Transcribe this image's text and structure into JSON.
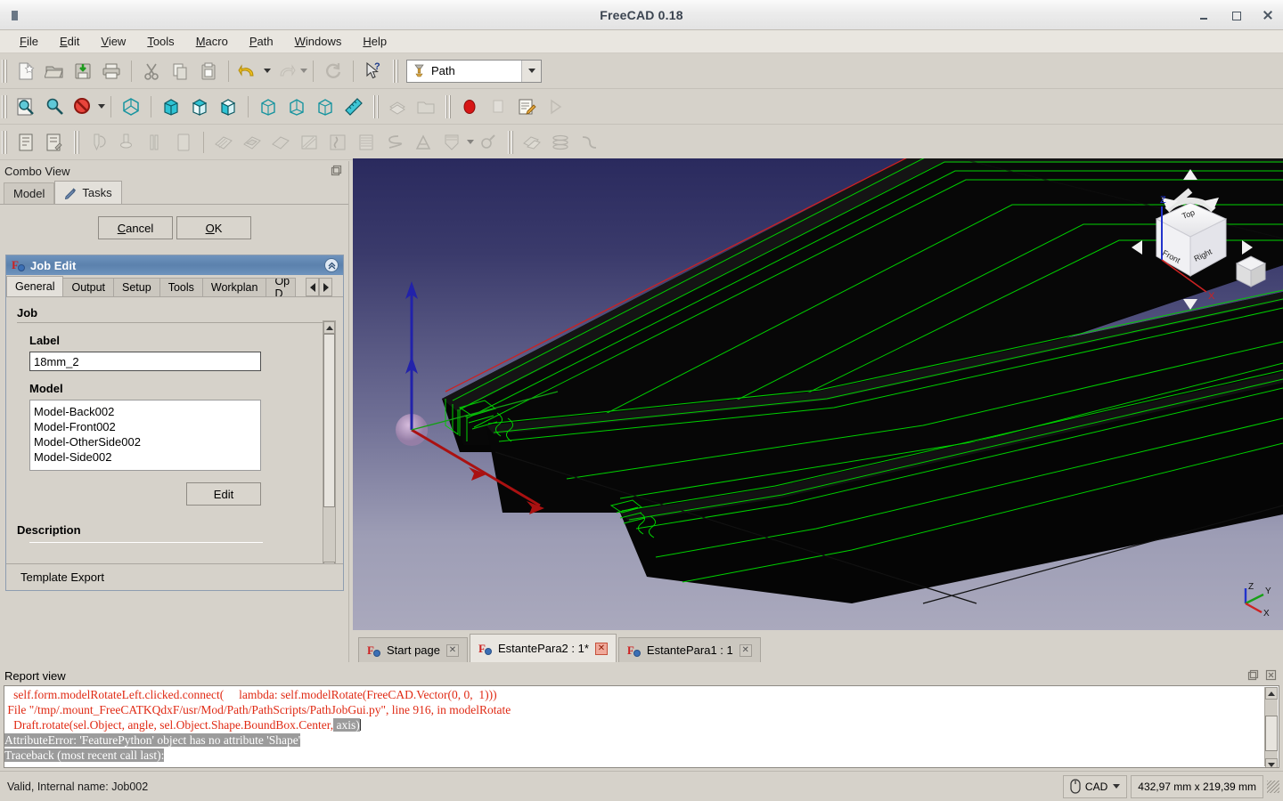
{
  "window": {
    "title": "FreeCAD 0.18",
    "app_icon": "freecad-icon",
    "controls": {
      "minimize": "minimize",
      "maximize": "maximize",
      "close": "close"
    }
  },
  "menubar": {
    "items": [
      {
        "label": "File",
        "mnemonic": "F"
      },
      {
        "label": "Edit",
        "mnemonic": "E"
      },
      {
        "label": "View",
        "mnemonic": "V"
      },
      {
        "label": "Tools",
        "mnemonic": "T"
      },
      {
        "label": "Macro",
        "mnemonic": "M"
      },
      {
        "label": "Path",
        "mnemonic": "P"
      },
      {
        "label": "Windows",
        "mnemonic": "W"
      },
      {
        "label": "Help",
        "mnemonic": "H"
      }
    ]
  },
  "toolbars": {
    "file": [
      "new-icon",
      "open-icon",
      "save-icon",
      "print-icon",
      "cut-icon",
      "copy-icon",
      "paste-icon",
      "undo-icon",
      "redo-icon",
      "refresh-icon",
      "whats-this-icon"
    ],
    "workbench_selector": {
      "value": "Path",
      "icon": "path-workbench-icon"
    },
    "view": [
      "fit-all-icon",
      "fit-selection-icon",
      "draw-style-icon",
      "axonometric-icon",
      "front-view-icon",
      "top-view-icon",
      "right-view-icon",
      "rear-view-icon",
      "bottom-view-icon",
      "left-view-icon",
      "measure-icon"
    ],
    "structure": [
      "create-part-icon",
      "create-group-icon"
    ],
    "macro": [
      "macro-record-icon",
      "macro-stop-icon",
      "macro-edit-icon",
      "macro-execute-icon"
    ],
    "path_job": [
      "job-create-icon",
      "job-edit-icon"
    ],
    "path_tool": [
      "tool-library-icon",
      "toolbit-dock-icon",
      "tool-drill-icon",
      "tool-shape-icon"
    ],
    "path_ops": [
      "profile-icon",
      "pocket-icon",
      "face-icon",
      "adaptive-icon",
      "drilling-icon",
      "surface-icon",
      "helix-icon",
      "engrave-icon",
      "slot-icon",
      "deburr-icon"
    ],
    "path_modify": [
      "copy-op-icon",
      "array-icon",
      "simple-copy-icon"
    ]
  },
  "combo_view": {
    "title": "Combo View",
    "float_button": "float-icon",
    "tabs": [
      {
        "label": "Model",
        "icon": "model-tab-icon",
        "active": false
      },
      {
        "label": "Tasks",
        "icon": "tasks-pencil-icon",
        "active": true
      }
    ],
    "dialog_buttons": {
      "cancel": "Cancel",
      "cancel_mnemonic": "C",
      "ok": "OK",
      "ok_mnemonic": "O"
    },
    "job_edit": {
      "title": "Job Edit",
      "icon": "freecad-gear-icon",
      "collapse_icon": "collapse-chevron-icon",
      "tabs": [
        {
          "label": "General",
          "active": true
        },
        {
          "label": "Output",
          "active": false
        },
        {
          "label": "Setup",
          "active": false
        },
        {
          "label": "Tools",
          "active": false
        },
        {
          "label": "Workplan",
          "active": false
        },
        {
          "label": "Op D",
          "active": false
        }
      ],
      "group_title": "Job",
      "label_caption": "Label",
      "label_value": "18mm_2",
      "model_caption": "Model",
      "model_items": [
        "Model-Back002",
        "Model-Front002",
        "Model-OtherSide002",
        "Model-Side002"
      ],
      "edit_button": "Edit",
      "description_caption": "Description",
      "template_export_caption": "Template Export"
    }
  },
  "view3d": {
    "navigation_cube": {
      "faces": [
        "Top",
        "Front",
        "Right"
      ],
      "arrows": [
        "rotate-left-arrow",
        "rotate-right-arrow",
        "pan-up-arrow",
        "pan-down-arrow",
        "pan-left-arrow",
        "pan-right-arrow"
      ],
      "corner_cube": "home-cube-icon"
    },
    "axis_cross": {
      "labels": [
        "Z",
        "Y",
        "X"
      ],
      "colors": {
        "x": "#cc2020",
        "y": "#18a018",
        "z": "#2020cc"
      }
    },
    "origin_marker": "origin-sphere",
    "colors": {
      "toolpath": "#00d000",
      "stock_edge": "#d02020",
      "model_fill": "#050505",
      "background_top": "#2a2a5e",
      "background_bottom": "#aaa9bd"
    }
  },
  "document_tabs": [
    {
      "label": "Start page",
      "active": false,
      "modified": false
    },
    {
      "label": "EstantePara2 : 1*",
      "active": true,
      "modified": true
    },
    {
      "label": "EstantePara1 : 1",
      "active": false,
      "modified": false
    }
  ],
  "report_view": {
    "title": "Report view",
    "float_button": "float-icon",
    "close_button": "close-icon",
    "lines": [
      {
        "text": "   self.form.modelRotateLeft.clicked.connect(     lambda: self.modelRotate(FreeCAD.Vector(0, 0,  1)))",
        "selected": false
      },
      {
        "text": " File \"/tmp/.mount_FreeCATKQdxF/usr/Mod/Path/PathScripts/PathJobGui.py\", line 916, in modelRotate",
        "selected": false
      },
      {
        "text": "   Draft.rotate(sel.Object, angle, sel.Object.Shape.BoundBox.Center,",
        "selected": false,
        "trailing_selected": " axis)"
      },
      {
        "text": "AttributeError: 'FeaturePython' object has no attribute 'Shape'",
        "selected": true
      },
      {
        "text": "Traceback (most recent call last):",
        "selected": true
      }
    ]
  },
  "statusbar": {
    "message": "Valid, Internal name: Job002",
    "nav_style": {
      "icon": "mouse-icon",
      "label": "CAD",
      "dropdown": "chevron-down-icon"
    },
    "dimensions": "432,97 mm x 219,39 mm"
  }
}
